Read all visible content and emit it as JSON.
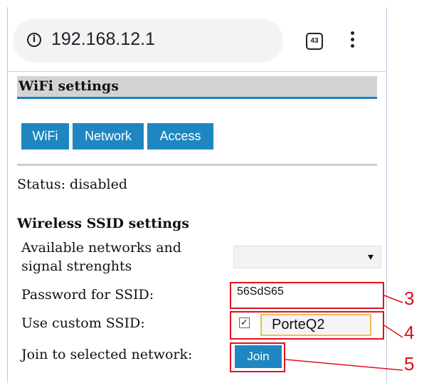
{
  "browser": {
    "url": "192.168.12.1",
    "tab_count": "43"
  },
  "page": {
    "title": "WiFi settings",
    "tabs": [
      "WiFi",
      "Network",
      "Access"
    ],
    "status": "Status: disabled",
    "section_title": "Wireless SSID settings",
    "available_networks_label": [
      "Available networks and",
      "signal strenghts"
    ],
    "password_label": "Password for SSID:",
    "password_value": "56SdS65",
    "custom_ssid_label": "Use custom SSID:",
    "custom_ssid_checked": "✓",
    "custom_ssid_value": "PorteQ2",
    "join_label": "Join to selected network:",
    "join_button": "Join"
  },
  "callouts": [
    "3",
    "4",
    "5"
  ],
  "colors": {
    "accent": "#1f86c1",
    "callout": "#e4101f"
  }
}
